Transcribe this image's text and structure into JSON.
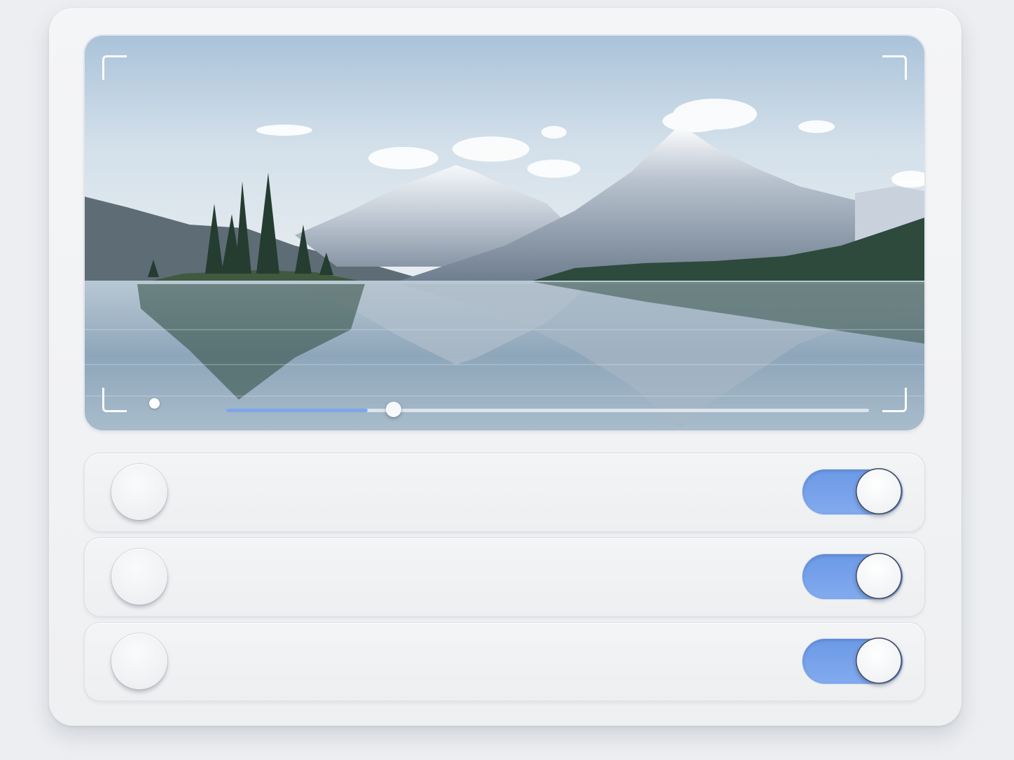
{
  "viewer": {
    "image": "mountain-lake-landscape",
    "playback_progress": 0.26,
    "buffered_progress": 0.22
  },
  "rows": [
    {
      "toggle_on": true
    },
    {
      "toggle_on": true
    },
    {
      "toggle_on": true
    }
  ],
  "colors": {
    "accent": "#7fa6e8",
    "panel": "#f3f4f6",
    "background": "#eceef1"
  }
}
